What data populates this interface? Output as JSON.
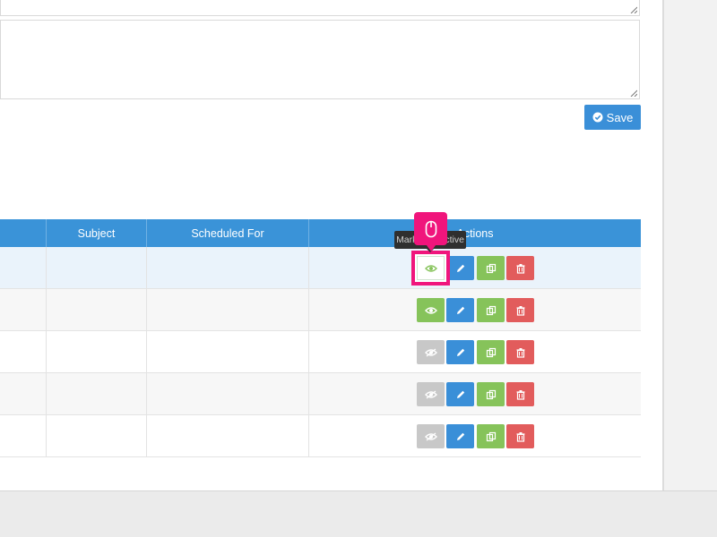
{
  "save_button": {
    "label": "Save",
    "icon": "check-circle-icon"
  },
  "table": {
    "headers": [
      "Subject",
      "Scheduled For",
      "Actions"
    ],
    "rows": [
      {
        "active": true
      },
      {
        "active": true
      },
      {
        "active": false
      },
      {
        "active": false
      },
      {
        "active": false
      }
    ]
  },
  "tooltip": {
    "text": "Mark as inactive"
  },
  "colors": {
    "header_blue": "#3a93d8",
    "green": "#86c35a",
    "blue": "#3a8fd8",
    "red": "#e25c5c",
    "gray": "#c8c8c8",
    "highlight_pink": "#f0157c"
  }
}
